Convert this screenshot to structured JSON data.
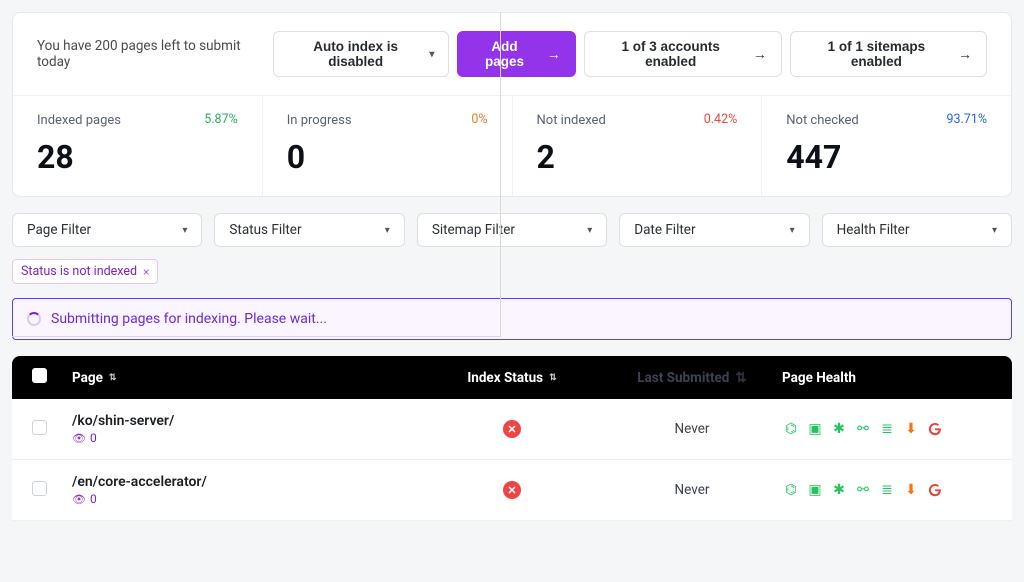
{
  "quota": "You have 200 pages left to submit today",
  "toolbar": {
    "auto_index": "Auto index is disabled",
    "add_pages": "Add pages",
    "accounts": "1 of 3 accounts enabled",
    "sitemaps": "1 of 1 sitemaps enabled"
  },
  "metrics": [
    {
      "label": "Indexed pages",
      "pct": "5.87%",
      "pct_class": "green",
      "value": "28"
    },
    {
      "label": "In progress",
      "pct": "0%",
      "pct_class": "orange",
      "value": "0"
    },
    {
      "label": "Not indexed",
      "pct": "0.42%",
      "pct_class": "red",
      "value": "2"
    },
    {
      "label": "Not checked",
      "pct": "93.71%",
      "pct_class": "blue",
      "value": "447"
    }
  ],
  "filters": {
    "page": "Page Filter",
    "status": "Status Filter",
    "sitemap": "Sitemap Filter",
    "date": "Date Filter",
    "health": "Health Filter"
  },
  "chip": {
    "label": "Status is not indexed"
  },
  "alert": "Submitting pages for indexing. Please wait...",
  "table": {
    "headers": {
      "page": "Page",
      "status": "Index Status",
      "last": "Last Submitted",
      "health": "Page Health"
    },
    "rows": [
      {
        "url": "/ko/shin-server/",
        "views": "0",
        "last": "Never"
      },
      {
        "url": "/en/core-accelerator/",
        "views": "0",
        "last": "Never"
      }
    ],
    "health_icons": [
      "sitemap",
      "doc",
      "bug",
      "link",
      "db",
      "dl",
      "g"
    ]
  }
}
